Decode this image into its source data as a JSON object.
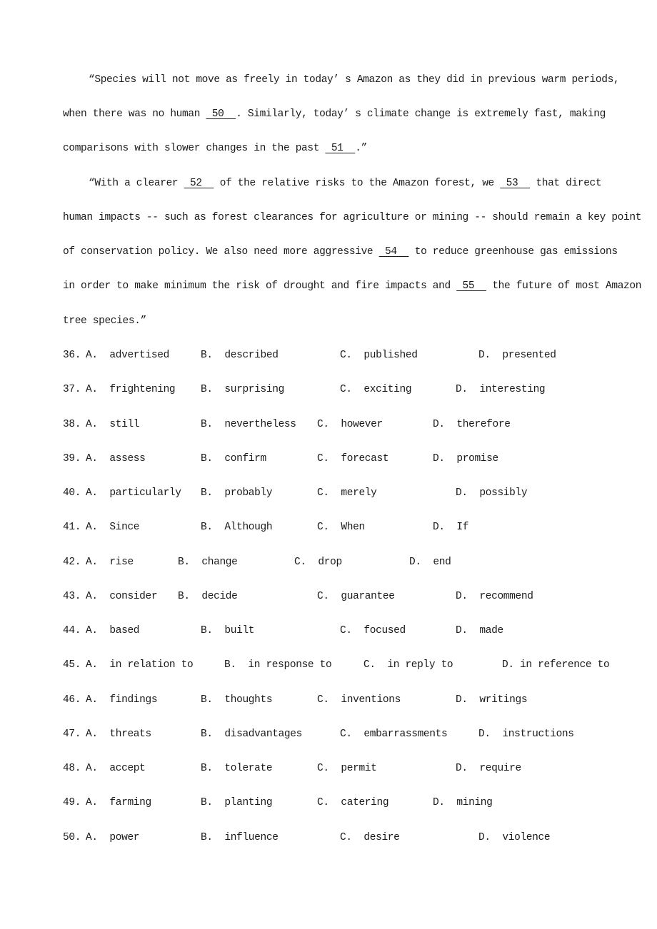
{
  "passage": {
    "p1": {
      "l1": "“Species will not move as freely in today’ s Amazon as they did in previous warm periods,",
      "l2a": "when there was no human ",
      "b50": " 50  ",
      "l2b": ". Similarly, today’ s climate change is extremely fast, making",
      "l3a": "comparisons with slower changes in the past ",
      "b51": " 51  ",
      "l3b": ".”"
    },
    "p2": {
      "l1a": "“With a clearer ",
      "b52": " 52  ",
      "l1b": " of the relative risks to the Amazon forest, we ",
      "b53": " 53  ",
      "l1c": " that direct",
      "l2": "human impacts -- such as forest clearances for agriculture or mining -- should remain a key point",
      "l3a": "of conservation policy. We also need more aggressive ",
      "b54": " 54  ",
      "l3b": " to reduce greenhouse gas emissions",
      "l4a": "in order to make minimum the risk of drought and fire impacts and ",
      "b55": " 55  ",
      "l4b": " the future of most Amazon",
      "l5": "tree species.”"
    }
  },
  "questions": [
    {
      "num": "36.",
      "a": "A.  advertised",
      "b": "B.  described",
      "c": "C.  published",
      "d": "D.  presented"
    },
    {
      "num": "37.",
      "a": "A.  frightening",
      "b": "B.  surprising",
      "c": "C.  exciting",
      "d": "D.  interesting"
    },
    {
      "num": "38.",
      "a": "A.  still",
      "b": "B.  nevertheless",
      "c": "C.  however",
      "d": "D.  therefore"
    },
    {
      "num": "39.",
      "a": "A.  assess",
      "b": "B.  confirm",
      "c": "C.  forecast",
      "d": "D.  promise"
    },
    {
      "num": "40.",
      "a": "A.  particularly",
      "b": "B.  probably",
      "c": "C.  merely",
      "d": "D.  possibly"
    },
    {
      "num": "41.",
      "a": "A.  Since",
      "b": "B.  Although",
      "c": "C.  When",
      "d": "D.  If"
    },
    {
      "num": "42.",
      "a": "A.  rise",
      "b": "B.  change",
      "c": "C.  drop",
      "d": "D.  end"
    },
    {
      "num": "43.",
      "a": "A.  consider",
      "b": "B.  decide",
      "c": "C.  guarantee",
      "d": "D.  recommend"
    },
    {
      "num": "44.",
      "a": "A.  based",
      "b": "B.  built",
      "c": "C.  focused",
      "d": "D.  made"
    },
    {
      "num": "45.",
      "a": "A.  in relation to",
      "b": "B.  in response to",
      "c": "C.  in reply to",
      "d": "D. in reference to"
    },
    {
      "num": "46.",
      "a": "A.  findings",
      "b": "B.  thoughts",
      "c": "C.  inventions",
      "d": "D.  writings"
    },
    {
      "num": "47.",
      "a": "A.  threats",
      "b": "B.  disadvantages",
      "c": "C.  embarrassments",
      "d": "D.  instructions"
    },
    {
      "num": "48.",
      "a": "A.  accept",
      "b": "B.  tolerate",
      "c": "C.  permit",
      "d": "D.  require"
    },
    {
      "num": "49.",
      "a": "A.  farming",
      "b": "B.  planting",
      "c": "C.  catering",
      "d": "D.  mining"
    },
    {
      "num": "50.",
      "a": "A.  power",
      "b": "B.  influence",
      "c": "C.  desire",
      "d": "D.  violence"
    }
  ]
}
